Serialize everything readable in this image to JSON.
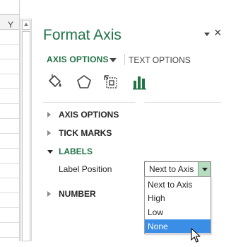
{
  "spreadsheet": {
    "column_letter": "Y"
  },
  "pane": {
    "title": "Format Axis",
    "close_glyph": "×",
    "tabs": [
      {
        "label": "AXIS OPTIONS",
        "selected": true
      },
      {
        "label": "TEXT OPTIONS",
        "selected": false
      }
    ],
    "icons": [
      "fill-line-icon",
      "effects-icon",
      "size-properties-icon",
      "axis-options-icon"
    ],
    "sections": {
      "axis_options": "AXIS OPTIONS",
      "tick_marks": "TICK MARKS",
      "labels": "LABELS",
      "number": "NUMBER"
    },
    "label_position": {
      "label": "Label Position",
      "selected": "Next to Axis",
      "options": [
        "Next to Axis",
        "High",
        "Low",
        "None"
      ],
      "highlighted": "None"
    }
  },
  "colors": {
    "accent": "#217346",
    "highlight": "#3a8ee6"
  }
}
